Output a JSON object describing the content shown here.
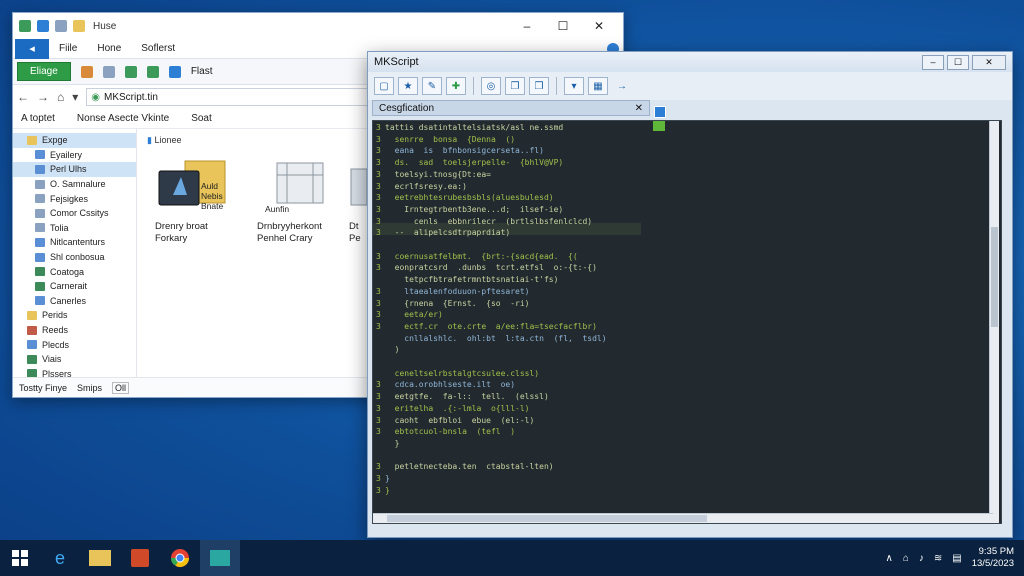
{
  "explorer": {
    "title": "Huse",
    "tabs": [
      "Fiile",
      "Hone",
      "Soflerst"
    ],
    "ribbon": {
      "primary": "Eliage",
      "item_label": "Flast"
    },
    "address": "MKScript.tin",
    "crumbs": [
      "A toptet",
      "Nonse Asecte Vkinte",
      "Soat"
    ],
    "nav": [
      {
        "label": "Expge",
        "color": "#e8c45a",
        "sel": true
      },
      {
        "label": "Eyailery",
        "color": "#5a8fd6"
      },
      {
        "label": "Perl Ulhs",
        "color": "#5a8fd6",
        "sel": true
      },
      {
        "label": "O. Samnalure",
        "color": "#8aa2bf"
      },
      {
        "label": "Fejsigkes",
        "color": "#8aa2bf"
      },
      {
        "label": "Comor Cssitys",
        "color": "#8aa2bf"
      },
      {
        "label": "Tolia",
        "color": "#8aa2bf"
      },
      {
        "label": "Nitlcantenturs",
        "color": "#5a8fd6"
      },
      {
        "label": "Shl conbosua",
        "color": "#5a8fd6"
      },
      {
        "label": "Coatoga",
        "color": "#3c8a5a"
      },
      {
        "label": "Carnerait",
        "color": "#3c8a5a"
      },
      {
        "label": "Canerles",
        "color": "#5a8fd6"
      },
      {
        "label": "Perids",
        "color": "#e8c45a"
      },
      {
        "label": "Reeds",
        "color": "#c25a4a"
      },
      {
        "label": "Plecds",
        "color": "#5a8fd6"
      },
      {
        "label": "Viais",
        "color": "#3c8a5a"
      },
      {
        "label": "Plssers",
        "color": "#3c8a5a"
      }
    ],
    "content_header": "Lionee",
    "files": [
      {
        "line1": "Drenry broat",
        "line2": "Forkary",
        "badge": "Auld Nebis Bnate"
      },
      {
        "line1": "Drnbryyherkont",
        "line2": "Penhel Crary",
        "badge": "Aunfin"
      },
      {
        "line1": "Dt",
        "line2": "Pe",
        "badge": ""
      }
    ],
    "status": [
      "Tostty Finye",
      "Smips",
      "Oll"
    ]
  },
  "editor": {
    "title": "MKScript",
    "panel": "Cesgfication",
    "gutter": [
      "3",
      "3",
      "3",
      "3",
      "3",
      "3",
      "3",
      "3",
      "3",
      "3",
      "",
      "3",
      "3",
      "",
      "3",
      "3",
      "3",
      "3",
      "",
      "",
      "",
      "",
      "3",
      "3",
      "3",
      "3",
      "3",
      "",
      "",
      "3",
      "3",
      "3"
    ],
    "code": [
      "tattis dsatintaltelsiatsk/asl ne.ssmd",
      "  senrre  bonsa  {Denna  ()",
      "  eana  is  bfnbonsigcerseta..fl)",
      "  ds.  sad  toelsjerpelle-  {bhlV@VP)",
      "  toelsyi.tnosg{Dt:ea=",
      "  ecrlfsresy.ea:)",
      "  eetrebhtesrubesbsbls(aluesbulesd)",
      "    Irntegtrbentb3ene...d;  ilsef-ie)",
      "      cenls  ebbnrilecr  (brtlslbsfenlclcd)",
      "  --  alipelcsdtrpaprdiat)",
      "",
      "  coernusatfelbmt.  {brt:-{sacd{ead.  {(",
      "  eonpratcsrd  .dunbs  tcrt.etfsl  o:-{t:-{)",
      "    tetpcfbtrafetrmntbtsnatiai-t'fs)",
      "    ltaealenfoduuon-pftesaret)",
      "    {rnena  {Ernst.  {so  -ri)",
      "    eeta/er)",
      "    ectf.cr  ote.crte  a/ee:fla=tsecfacflbr)",
      "    cnllalshlc.  ohl:bt  l:ta.ctn  (fl,  tsdl)",
      "  )",
      "",
      "  ceneltselrbstalgtcsulee.clssl)",
      "  cdca.orobhlseste.ilt  oe)",
      "  eetgtfe.  fa-l::  tell.  (elssl)",
      "  eritelha  .{:-lmla  o{lll-l)",
      "  caoht  ebfbloi  ebue  (el:-l)",
      "  ebtotcuol-bnsla  (tefl  )",
      "  }",
      "",
      "  petletnecteba.ten  ctabstal-lten)",
      "}",
      "}"
    ]
  },
  "taskbar": {
    "time": "9:35 PM",
    "date": "13/5/2023"
  }
}
